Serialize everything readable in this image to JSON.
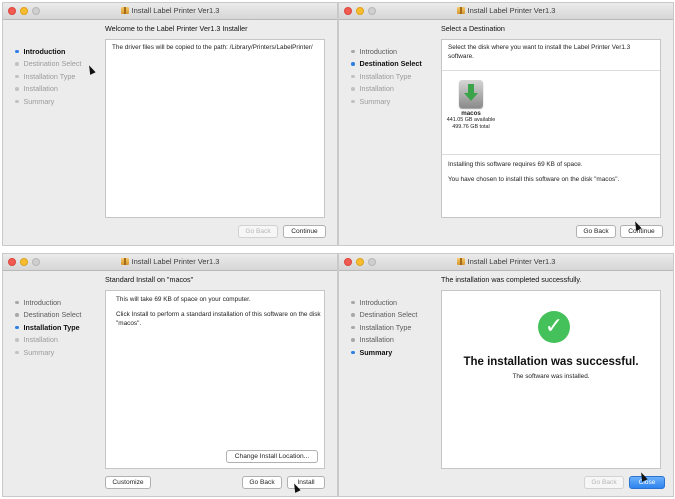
{
  "app_title": "Install Label Printer Ver1.3",
  "steps": [
    "Introduction",
    "Destination Select",
    "Installation Type",
    "Installation",
    "Summary"
  ],
  "colors": {
    "accent": "#2e7fe6",
    "success": "#44c15a"
  },
  "panel1": {
    "heading": "Welcome to the Label Printer Ver1.3 Installer",
    "body": "The driver files will be copied to the path: /Library/Printers/LabelPrinter/",
    "go_back": "Go Back",
    "continue": "Continue"
  },
  "panel2": {
    "heading": "Select a Destination",
    "prompt": "Select the disk where you want to install the Label Printer Ver1.3 software.",
    "disk_name": "macos",
    "disk_available": "441.05 GB available",
    "disk_total": "499.76 GB total",
    "space_note": "Installing this software requires 69 KB of space.",
    "chosen_note": "You have chosen to install this software on the disk \"macos\".",
    "go_back": "Go Back",
    "continue": "Continue"
  },
  "panel3": {
    "heading": "Standard Install on \"macos\"",
    "line1": "This will take 69 KB of space on your computer.",
    "line2": "Click Install to perform a standard installation of this software on the disk \"macos\".",
    "change_location": "Change Install Location...",
    "customize": "Customize",
    "go_back": "Go Back",
    "install": "Install"
  },
  "panel4": {
    "heading": "The installation was completed successfully.",
    "success_title": "The installation was successful.",
    "success_sub": "The software was installed.",
    "go_back": "Go Back",
    "close": "Close"
  }
}
